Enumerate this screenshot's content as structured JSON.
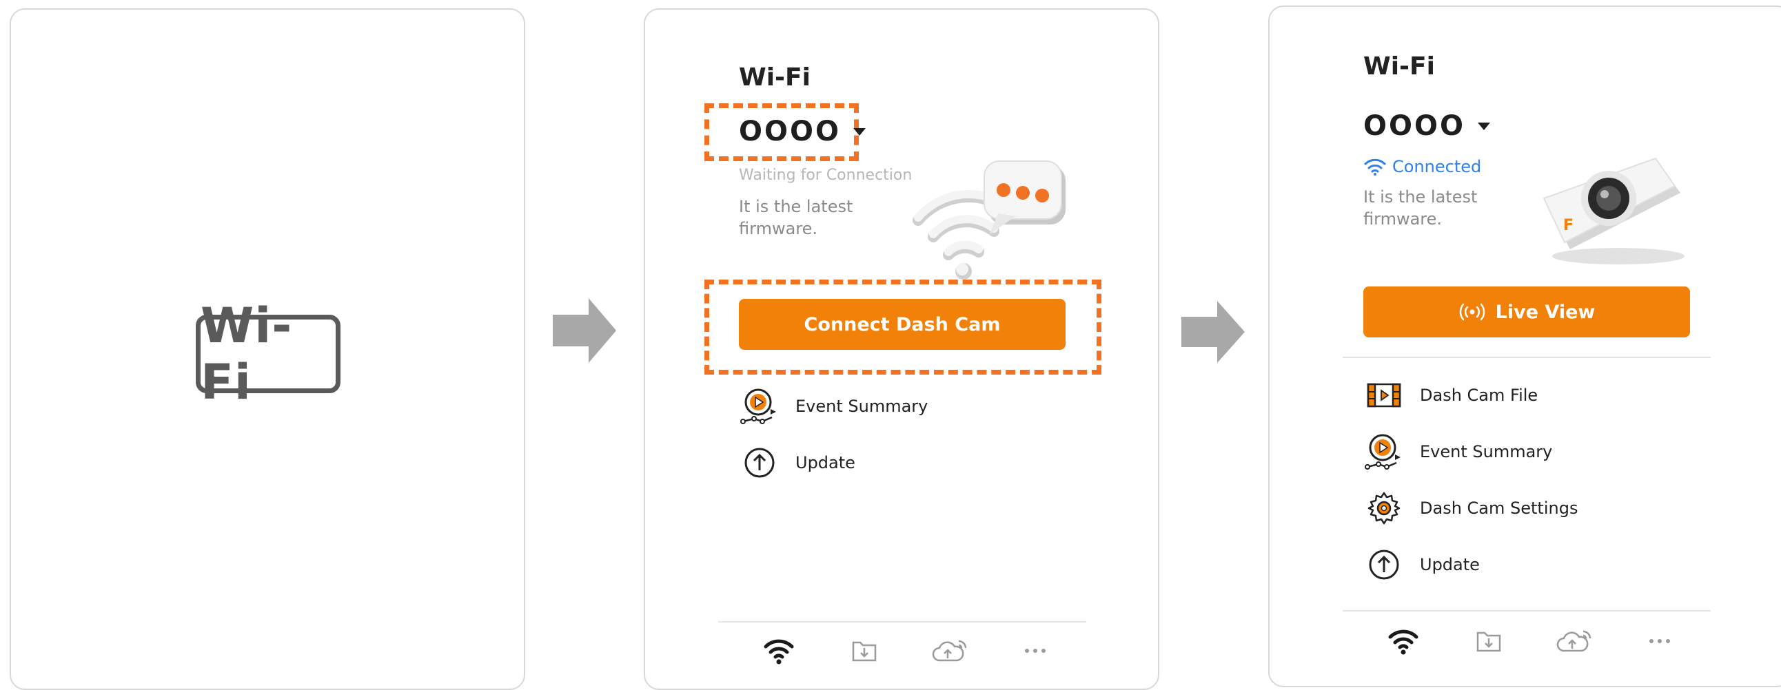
{
  "panel1": {
    "logo_text": "Wi-Fi"
  },
  "panel2": {
    "title": "Wi-Fi",
    "ssid": "OOOO",
    "status": "Waiting for Connection",
    "firmware_text": "It is the latest firmware.",
    "connect_button": "Connect Dash Cam",
    "menu": [
      {
        "label": "Event Summary",
        "icon": "event-summary-icon"
      },
      {
        "label": "Update",
        "icon": "update-icon"
      }
    ],
    "tabs": [
      "wifi-icon",
      "download-folder-icon",
      "cloud-upload-icon",
      "more-icon"
    ]
  },
  "panel3": {
    "title": "Wi-Fi",
    "ssid": "OOOO",
    "status": "Connected",
    "firmware_text": "It is the latest firmware.",
    "live_view_button": "Live View",
    "menu": [
      {
        "label": "Dash Cam File",
        "icon": "film-icon"
      },
      {
        "label": "Event Summary",
        "icon": "event-summary-icon"
      },
      {
        "label": "Dash Cam Settings",
        "icon": "settings-gear-icon"
      },
      {
        "label": "Update",
        "icon": "update-icon"
      }
    ],
    "tabs": [
      "wifi-icon",
      "download-folder-icon",
      "cloud-upload-icon",
      "more-icon"
    ]
  },
  "colors": {
    "accent": "#f28109",
    "highlight": "#f07222",
    "connected": "#2f80ed",
    "gray_arrow": "#a8a8a8"
  }
}
